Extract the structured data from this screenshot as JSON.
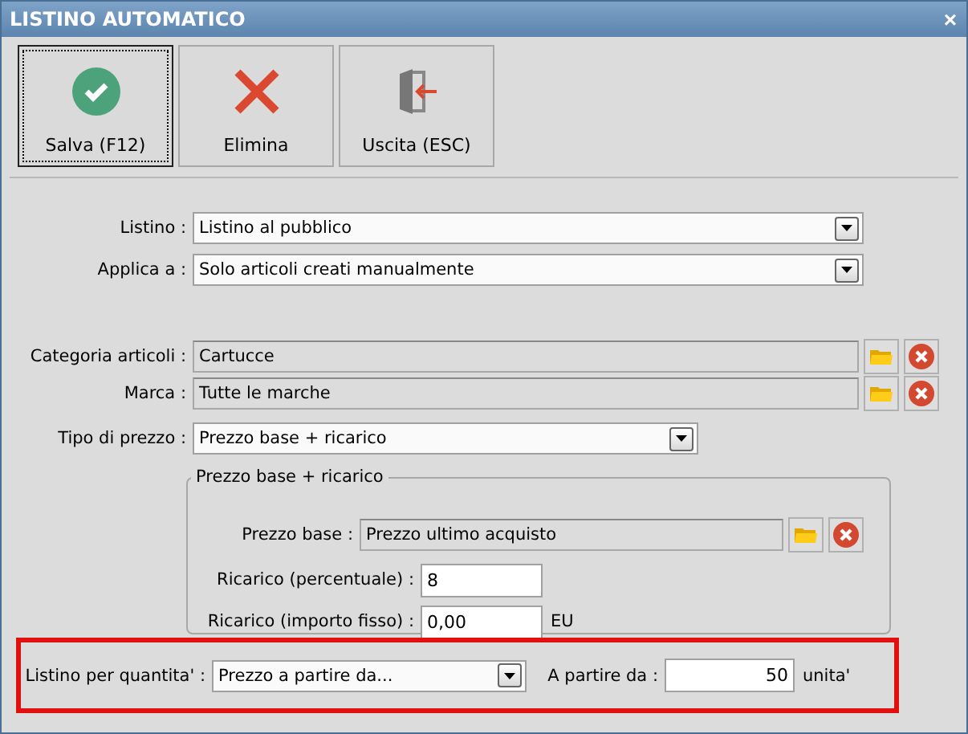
{
  "window": {
    "title": "LISTINO AUTOMATICO",
    "close": "×"
  },
  "toolbar": [
    {
      "label": "Salva (F12)",
      "kind": "save",
      "focused": true
    },
    {
      "label": "Elimina",
      "kind": "delete",
      "focused": false
    },
    {
      "label": "Uscita (ESC)",
      "kind": "exit",
      "focused": false
    }
  ],
  "selects": [
    {
      "label": "Listino :",
      "value": "Listino al pubblico"
    },
    {
      "label": "Applica a :",
      "value": "Solo articoli creati manualmente"
    }
  ],
  "lookups": [
    {
      "label": "Categoria articoli :",
      "value": "Cartucce"
    },
    {
      "label": "Marca :",
      "value": "Tutte le marche"
    }
  ],
  "price_type": {
    "label": "Tipo di prezzo :",
    "value": "Prezzo base + ricarico"
  },
  "group": {
    "legend": "Prezzo base + ricarico",
    "rows": [
      {
        "kind": "lookup",
        "label": "Prezzo base :",
        "value": "Prezzo ultimo acquisto"
      },
      {
        "kind": "input",
        "label": "Ricarico (percentuale) :",
        "value": "8"
      },
      {
        "kind": "input",
        "label": "Ricarico (importo fisso) :",
        "value": "0,00",
        "unit": "EU"
      }
    ]
  },
  "quantity": {
    "label": "Listino per quantita' :",
    "value": "Prezzo a partire da...",
    "from_label": "A partire da :",
    "from_value": "50",
    "unit": "unita'"
  }
}
